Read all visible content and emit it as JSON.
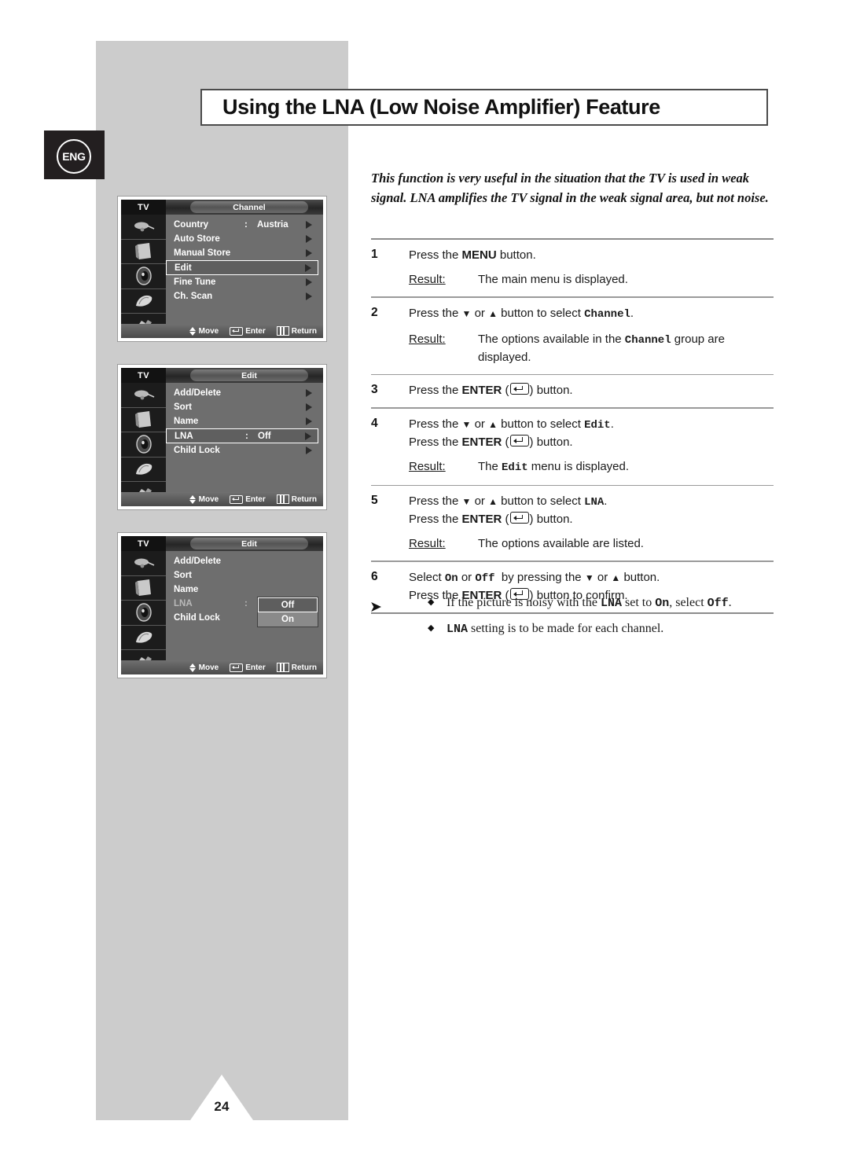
{
  "page": {
    "number": "24",
    "language_badge": "ENG",
    "title": "Using the LNA (Low Noise Amplifier) Feature"
  },
  "intro": "This function is very useful in the situation that the TV is used in weak signal. LNA amplifies the TV signal in the weak signal area, but not noise.",
  "labels": {
    "result": "Result:",
    "press_the": "Press the",
    "button_word": "button.",
    "or_word": "or",
    "to_select": "button to select",
    "enter_word": "ENTER",
    "menu_word": "MENU"
  },
  "steps": [
    {
      "num": "1",
      "lines": [
        "Press the MENU button."
      ],
      "result": "The main menu is displayed."
    },
    {
      "num": "2",
      "lines": [
        "Press the ▼ or ▲ button to select Channel."
      ],
      "result": "The options available in the Channel group are displayed."
    },
    {
      "num": "3",
      "lines": [
        "Press the ENTER (  ) button."
      ],
      "result": ""
    },
    {
      "num": "4",
      "lines": [
        "Press the ▼ or ▲ button to select Edit.",
        "Press the ENTER (  ) button."
      ],
      "result": "The Edit menu is displayed."
    },
    {
      "num": "5",
      "lines": [
        "Press the ▼ or ▲ button to select LNA.",
        "Press the ENTER (  ) button."
      ],
      "result": "The options available are listed."
    },
    {
      "num": "6",
      "lines": [
        "Select On or Off  by pressing the ▼ or ▲ button.",
        "Press the ENTER (  ) button to confirm."
      ],
      "result": ""
    }
  ],
  "notes": {
    "arrow_glyph": "➤",
    "bullet_glyph": "◆",
    "items": [
      "If the picture is noisy with the LNA set to On, select Off.",
      "LNA setting is to be made for each channel."
    ]
  },
  "osd_common": {
    "tv_label": "TV",
    "footer": {
      "move": "Move",
      "enter": "Enter",
      "return": "Return"
    },
    "icons": [
      "antenna-icon",
      "tv-set-icon",
      "speaker-icon",
      "feature-icon",
      "setup-icon"
    ]
  },
  "osd_menus": [
    {
      "title": "Channel",
      "rows": [
        {
          "label": "Country",
          "colon": ":",
          "value": "Austria",
          "arrow": true,
          "selected": false
        },
        {
          "label": "Auto Store",
          "colon": "",
          "value": "",
          "arrow": true,
          "selected": false
        },
        {
          "label": "Manual Store",
          "colon": "",
          "value": "",
          "arrow": true,
          "selected": false
        },
        {
          "label": "Edit",
          "colon": "",
          "value": "",
          "arrow": true,
          "selected": true
        },
        {
          "label": "Fine Tune",
          "colon": "",
          "value": "",
          "arrow": true,
          "selected": false
        },
        {
          "label": "Ch. Scan",
          "colon": "",
          "value": "",
          "arrow": true,
          "selected": false
        }
      ]
    },
    {
      "title": "Edit",
      "rows": [
        {
          "label": "Add/Delete",
          "colon": "",
          "value": "",
          "arrow": true,
          "selected": false
        },
        {
          "label": "Sort",
          "colon": "",
          "value": "",
          "arrow": true,
          "selected": false
        },
        {
          "label": "Name",
          "colon": "",
          "value": "",
          "arrow": true,
          "selected": false
        },
        {
          "label": "LNA",
          "colon": ":",
          "value": "Off",
          "arrow": true,
          "selected": true
        },
        {
          "label": "Child Lock",
          "colon": "",
          "value": "",
          "arrow": true,
          "selected": false
        }
      ]
    },
    {
      "title": "Edit",
      "rows": [
        {
          "label": "Add/Delete",
          "colon": "",
          "value": "",
          "arrow": false,
          "selected": false
        },
        {
          "label": "Sort",
          "colon": "",
          "value": "",
          "arrow": false,
          "selected": false
        },
        {
          "label": "Name",
          "colon": "",
          "value": "",
          "arrow": false,
          "selected": false
        },
        {
          "label": "LNA",
          "colon": ":",
          "value": "",
          "arrow": false,
          "selected": false,
          "dim": true
        },
        {
          "label": "Child Lock",
          "colon": "",
          "value": "",
          "arrow": false,
          "selected": false
        }
      ],
      "dropdown": {
        "options": [
          {
            "label": "Off",
            "selected": true
          },
          {
            "label": "On",
            "selected": false
          }
        ]
      }
    }
  ]
}
